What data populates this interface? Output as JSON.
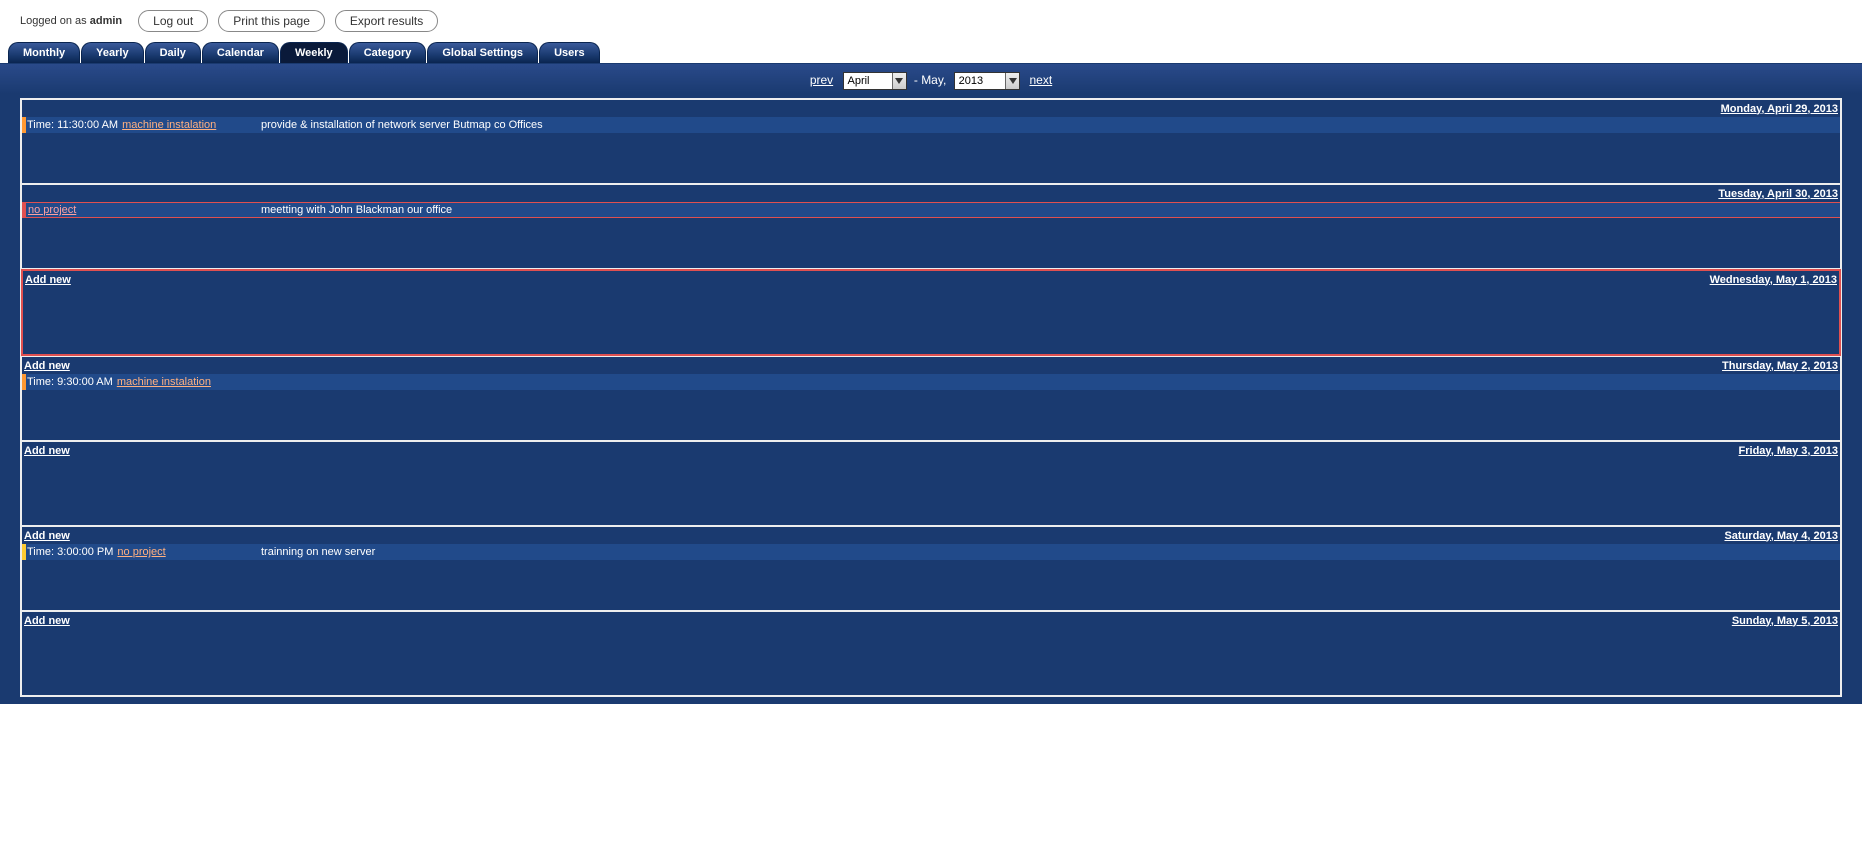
{
  "header": {
    "logged_prefix": "Logged on as ",
    "user": "admin",
    "logout": "Log out",
    "print": "Print this page",
    "export": "Export results"
  },
  "tabs": [
    "Monthly",
    "Yearly",
    "Daily",
    "Calendar",
    "Weekly",
    "Category",
    "Global Settings",
    "Users"
  ],
  "active_tab": 4,
  "nav": {
    "prev": "prev",
    "month": "April",
    "sep": "- May,",
    "year": "2013",
    "next": "next"
  },
  "add_new_label": "Add new",
  "days": [
    {
      "date": "Monday, April 29, 2013",
      "events": [
        {
          "marker": "orange-marker",
          "time": "Time: 11:30:00 AM",
          "proj": "machine instalation",
          "proj_cls": "",
          "desc": "provide & installation of network server Butmap co Offices"
        }
      ],
      "show_add": false,
      "today": false
    },
    {
      "date": "Tuesday, April 30, 2013",
      "events": [
        {
          "marker": "red-hl",
          "time": "",
          "proj": "no project",
          "proj_cls": "noproj",
          "desc": "meetting with John Blackman our office",
          "full_red": true
        }
      ],
      "show_add": false,
      "today": false
    },
    {
      "date": "Wednesday, May 1, 2013",
      "events": [],
      "show_add": true,
      "today": true
    },
    {
      "date": "Thursday, May 2, 2013",
      "events": [
        {
          "marker": "orange-marker",
          "time": "Time: 9:30:00 AM",
          "proj": "machine instalation",
          "proj_cls": "",
          "desc": ""
        }
      ],
      "show_add": true,
      "today": false
    },
    {
      "date": "Friday, May 3, 2013",
      "events": [],
      "show_add": true,
      "today": false
    },
    {
      "date": "Saturday, May 4, 2013",
      "events": [
        {
          "marker": "yellow-marker",
          "time": "Time: 3:00:00 PM",
          "proj": "no project",
          "proj_cls": "",
          "desc": "trainning on new server"
        }
      ],
      "show_add": true,
      "today": false
    },
    {
      "date": "Sunday, May 5, 2013",
      "events": [],
      "show_add": true,
      "today": false
    }
  ]
}
